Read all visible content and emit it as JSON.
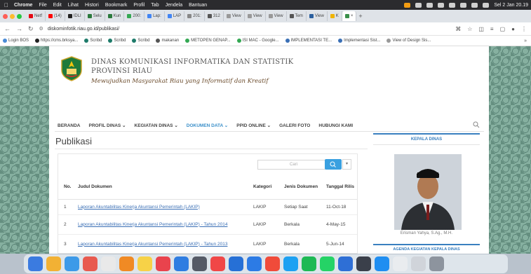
{
  "menubar": {
    "app": "Chrome",
    "items": [
      "File",
      "Edit",
      "Lihat",
      "Histori",
      "Bookmark",
      "Profil",
      "Tab",
      "Jendela",
      "Bantuan"
    ],
    "clock": "Sel 2 Jan 20.19"
  },
  "tabs": [
    {
      "label": "Netf",
      "color": "#e50914"
    },
    {
      "label": "(14)",
      "color": "#ff0000"
    },
    {
      "label": "IDLI",
      "color": "#222222"
    },
    {
      "label": "Selu",
      "color": "#2b7a3d"
    },
    {
      "label": "Kun",
      "color": "#2b7a3d"
    },
    {
      "label": "200:",
      "color": "#34a853"
    },
    {
      "label": "Lap:",
      "color": "#4285f4"
    },
    {
      "label": "LAP",
      "color": "#4285f4"
    },
    {
      "label": "201:",
      "color": "#888888"
    },
    {
      "label": "312",
      "color": "#555555"
    },
    {
      "label": "View",
      "color": "#999999"
    },
    {
      "label": "View",
      "color": "#999999"
    },
    {
      "label": "View",
      "color": "#999999"
    },
    {
      "label": "Tem",
      "color": "#555555"
    },
    {
      "label": "View",
      "color": "#2b5f9e"
    },
    {
      "label": "K",
      "color": "#f0b400"
    }
  ],
  "active_tab_close": "×",
  "address": {
    "url": "diskominfotik.riau.go.id/publikasi/"
  },
  "bookmarks": [
    "Login BOS",
    "https://cms.brksya...",
    "Scribd",
    "Scribd",
    "Scribd",
    "makanan",
    "METOPEN GENAP...",
    "ISI MAC - Google...",
    "IMPLEMENTASI TE...",
    "Implementasi Sist...",
    "View of Design Sis..."
  ],
  "bookmarks_more": "»",
  "site": {
    "title_line1": "DINAS KOMUNIKASI INFORMATIKA DAN STATISTIK",
    "title_line2": "PROVINSI RIAU",
    "tagline": "Mewujudkan Masyarakat Riau yang Informatif dan Kreatif"
  },
  "nav": [
    {
      "label": "BERANDA",
      "active": false
    },
    {
      "label": "PROFIL DINAS ⌄",
      "active": false
    },
    {
      "label": "KEGIATAN DINAS ⌄",
      "active": false
    },
    {
      "label": "DOKUMEN DATA ⌄",
      "active": true
    },
    {
      "label": "PPID ONLINE ⌄",
      "active": false
    },
    {
      "label": "GALERI FOTO",
      "active": false
    },
    {
      "label": "HUBUNGI KAMI",
      "active": false
    }
  ],
  "page_title": "Publikasi",
  "table": {
    "search_placeholder": "Cari",
    "dropdown": "▾",
    "headers": {
      "no": "No.",
      "judul": "Judul Dokumen",
      "kategori": "Kategori",
      "jenis": "Jenis Dokumen",
      "tanggal": "Tanggal Rilis"
    },
    "rows": [
      {
        "no": "1",
        "judul": "Laporan Akuntabilitas Kinerja Akuntansi Pemerintah (LAKIP)",
        "kategori": "LAKIP",
        "jenis": "Setiap Saat",
        "tanggal": "11-Oct-18"
      },
      {
        "no": "2",
        "judul": "Laporan Akuntabilitas Kinerja Akuntansi Pemerintah (LAKIP) - Tahun 2014",
        "kategori": "LAKIP",
        "jenis": "Berkala",
        "tanggal": "4-May-15"
      },
      {
        "no": "3",
        "judul": "Laporan Akuntabilitas Kinerja Akuntansi Pemerintah (LAKIP) - Tahun 2013",
        "kategori": "LAKIP",
        "jenis": "Berkala",
        "tanggal": "5-Jun-14"
      }
    ]
  },
  "sidebar": {
    "head": "KEPALA DINAS",
    "caption": "Erisman Yahya, S.Ag., M.H.",
    "head2": "AGENDA KEGIATAN KEPALA DINAS"
  },
  "dock": {
    "colors": [
      "#3b7be0",
      "#f2b134",
      "#3d9ae8",
      "#e85a4f",
      "#e9e9e9",
      "#f08a24",
      "#f7d247",
      "#e9434d",
      "#2f7de1",
      "#555a66",
      "#f04747",
      "#2670d6",
      "#2c7be5",
      "#f04b3a",
      "#1da1f2",
      "#1db954",
      "#25d366",
      "#2e6fd6",
      "#3a3f4a",
      "#1f8ef1",
      "#e9ecef",
      "#d0d4da",
      "#8d949e"
    ]
  }
}
